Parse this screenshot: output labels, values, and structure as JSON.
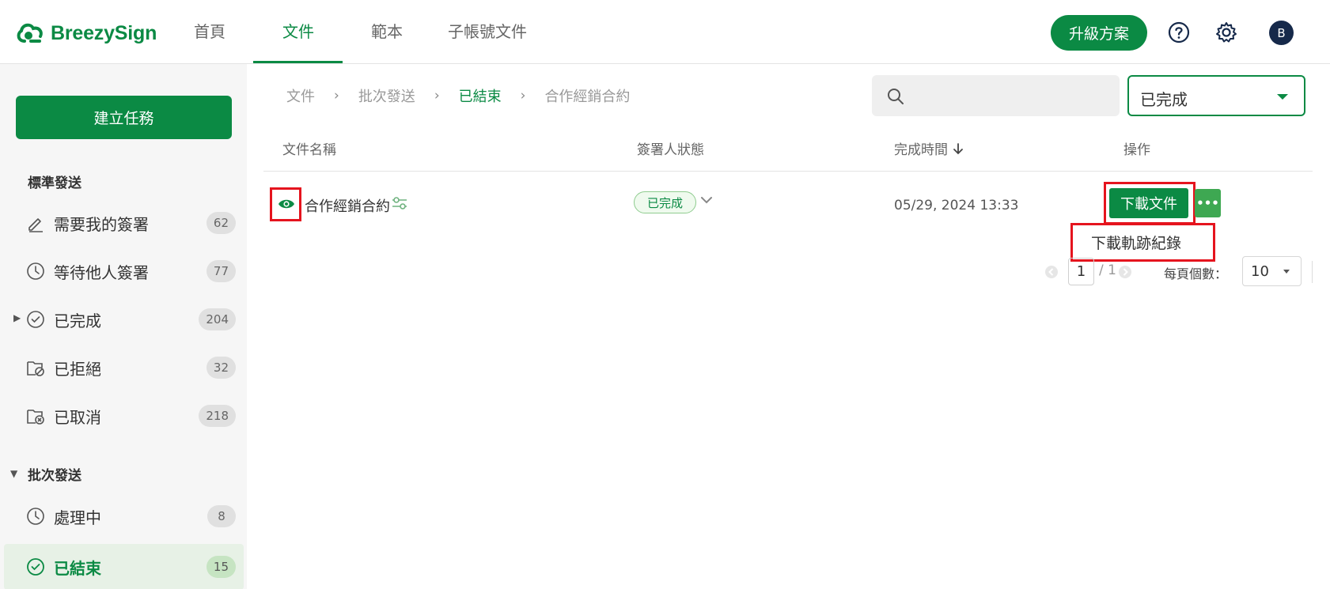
{
  "app": {
    "name": "BreezySign"
  },
  "nav": {
    "tabs": [
      {
        "label": "首頁",
        "active": false
      },
      {
        "label": "文件",
        "active": true
      },
      {
        "label": "範本",
        "active": false
      },
      {
        "label": "子帳號文件",
        "active": false
      }
    ],
    "upgrade_label": "升級方案",
    "avatar_initial": "B"
  },
  "sidebar": {
    "create_label": "建立任務",
    "standard_title": "標準發送",
    "standard_items": [
      {
        "label": "需要我的簽署",
        "count": "62",
        "icon": "pen-icon"
      },
      {
        "label": "等待他人簽署",
        "count": "77",
        "icon": "clock-icon"
      },
      {
        "label": "已完成",
        "count": "204",
        "icon": "check-circle-icon"
      },
      {
        "label": "已拒絕",
        "count": "32",
        "icon": "folder-rejected-icon"
      },
      {
        "label": "已取消",
        "count": "218",
        "icon": "folder-cancelled-icon"
      }
    ],
    "batch_title": "批次發送",
    "batch_items": [
      {
        "label": "處理中",
        "count": "8",
        "icon": "clock-icon"
      },
      {
        "label": "已結束",
        "count": "15",
        "icon": "check-circle-icon",
        "active": true
      }
    ]
  },
  "breadcrumb": [
    "文件",
    "批次發送",
    "已結束",
    "合作經銷合約"
  ],
  "search": {
    "placeholder": ""
  },
  "filter": {
    "value": "已完成"
  },
  "table": {
    "headers": [
      "文件名稱",
      "簽署人狀態",
      "完成時間",
      "操作"
    ],
    "rows": [
      {
        "name": "合作經銷合約",
        "status": "已完成",
        "completed_at": "05/29, 2024 13:33",
        "download_label": "下載文件",
        "more_label": "•••"
      }
    ]
  },
  "dropdown_menu": {
    "items": [
      "下載軌跡紀錄"
    ]
  },
  "pagination": {
    "current": "1",
    "total": "/ 1",
    "per_page_label": "每頁個數：",
    "per_page_value": "10"
  },
  "colors": {
    "accent": "#0b8a44",
    "highlight": "#e5141e",
    "active_bg": "#e7f1e6"
  }
}
